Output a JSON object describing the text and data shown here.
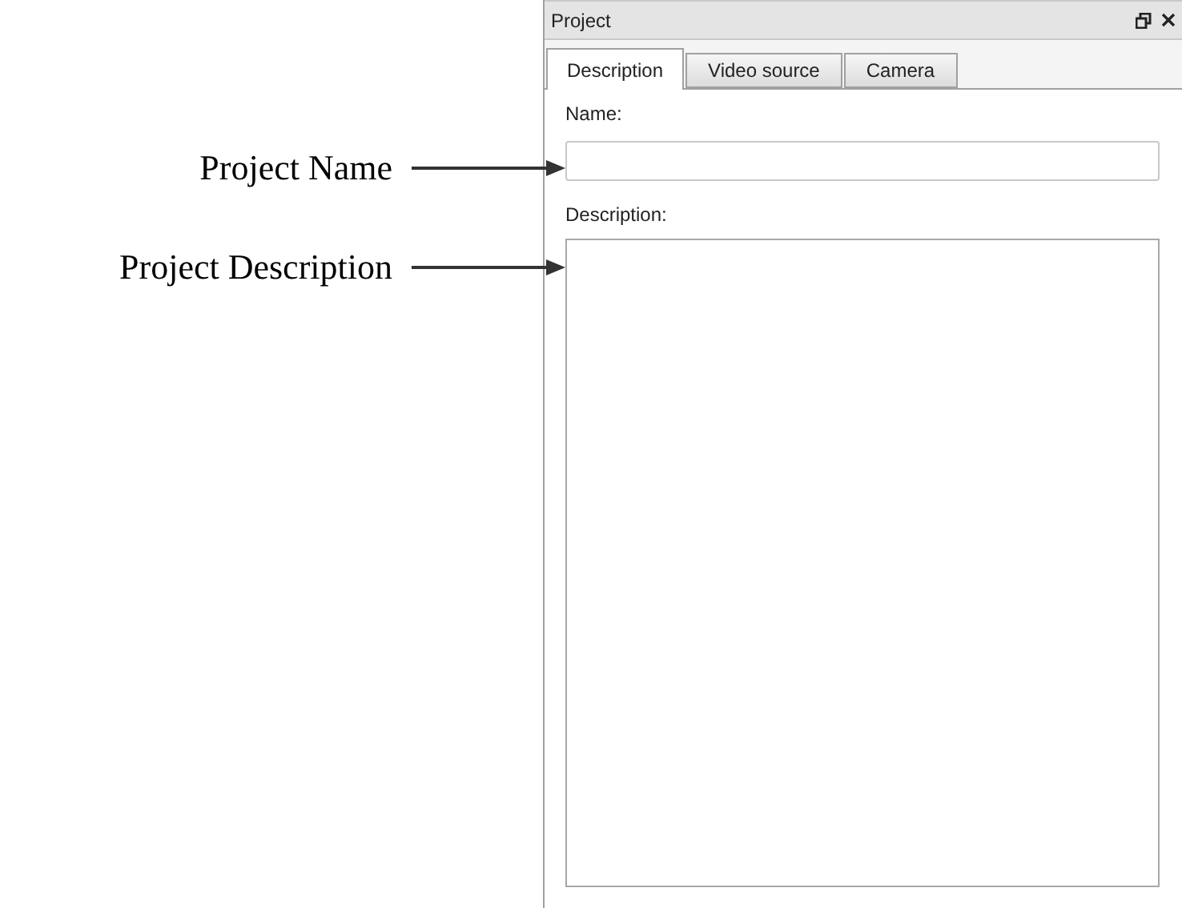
{
  "annotations": [
    {
      "label": "Project Name"
    },
    {
      "label": "Project Description"
    }
  ],
  "panel": {
    "title": "Project",
    "tabs": [
      {
        "label": "Description",
        "selected": true
      },
      {
        "label": "Video source",
        "selected": false
      },
      {
        "label": "Camera",
        "selected": false
      }
    ],
    "fields": [
      {
        "label": "Name:",
        "kind": "input"
      },
      {
        "label": "Description:",
        "kind": "textarea"
      }
    ]
  }
}
